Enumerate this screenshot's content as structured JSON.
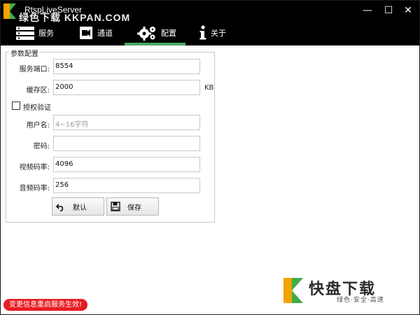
{
  "window": {
    "title": "RtspLiveServer",
    "watermark": "绿色下载  KKPAN.COM",
    "minimize_label": "—",
    "maximize_label": "☐",
    "close_label": "✕"
  },
  "nav": {
    "tabs": [
      {
        "label": "服务",
        "icon": "server-icon"
      },
      {
        "label": "通道",
        "icon": "camera-icon"
      },
      {
        "label": "配置",
        "icon": "gears-icon",
        "active": true
      },
      {
        "label": "关于",
        "icon": "info-icon"
      }
    ]
  },
  "config": {
    "group_title": "参数配置",
    "service_port_label": "服务端口:",
    "service_port_value": "8554",
    "buffer_label": "缓存区:",
    "buffer_value": "2000",
    "buffer_unit": "KB",
    "auth_label": "授权验证",
    "auth_checked": false,
    "username_label": "用户名:",
    "username_placeholder": "4~16字符",
    "password_label": "密码:",
    "password_value": "",
    "video_bitrate_label": "视频码率:",
    "video_bitrate_value": "4096",
    "audio_bitrate_label": "音频码率:",
    "audio_bitrate_value": "256",
    "default_button": "默认",
    "save_button": "保存"
  },
  "status": {
    "message": "变更信息重启服务生效!",
    "color": "#e81d23"
  },
  "branding": {
    "name": "快盘下载",
    "tagline": "绿色·安全·高速"
  },
  "colors": {
    "titlebar": "#000000",
    "active_tab_indicator": "#4aa864"
  }
}
